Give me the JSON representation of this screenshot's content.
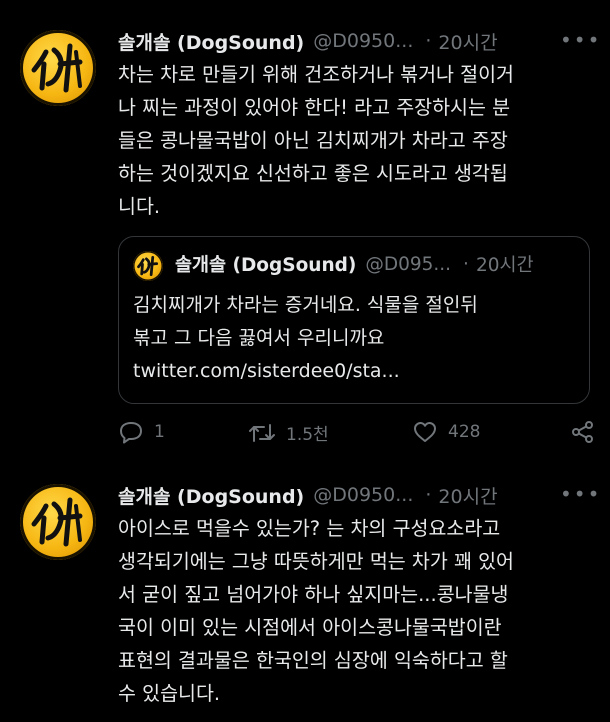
{
  "tweet1": {
    "name": "솔개솔 (DogSound)",
    "handle": "@D0950...",
    "dot": "·",
    "time": "20시간",
    "more": "•••",
    "text": "차는 차로 만들기 위해 건조하거나 볶거나 절이거\n나 찌는 과정이 있어야 한다! 라고 주장하시는 분\n들은 콩나물국밥이 아닌 김치찌개가 차라고 주장\n하는 것이겠지요 신선하고 좋은 시도라고 생각됩\n니다.",
    "quote": {
      "name": "솔개솔 (DogSound)",
      "handle": "@D095...",
      "dot": "·",
      "time": "20시간",
      "text": "김치찌개가 차라는 증거네요. 식물을 절인뒤\n볶고 그 다음 끓여서 우리니까요\ntwitter.com/sisterdee0/sta..."
    },
    "actions": {
      "reply_count": "1",
      "retweet_count": "1.5천",
      "like_count": "428"
    }
  },
  "tweet2": {
    "name": "솔개솔 (DogSound)",
    "handle": "@D0950...",
    "dot": "·",
    "time": "20시간",
    "more": "•••",
    "text": "아이스로 먹을수 있는가? 는 차의 구성요소라고\n생각되기에는 그냥 따뜻하게만 먹는 차가 꽤 있어\n서 굳이 짚고 넘어가야 하나 싶지마는...콩나물냉\n국이 이미 있는 시점에서 아이스콩나물국밥이란\n표현의 결과물은 한국인의 심장에 익숙하다고 할\n수 있습니다."
  },
  "colors": {
    "background": "#000000",
    "text": "#e7e9ea",
    "muted": "#71767b",
    "border": "#333639",
    "avatar": "#f6b612"
  }
}
